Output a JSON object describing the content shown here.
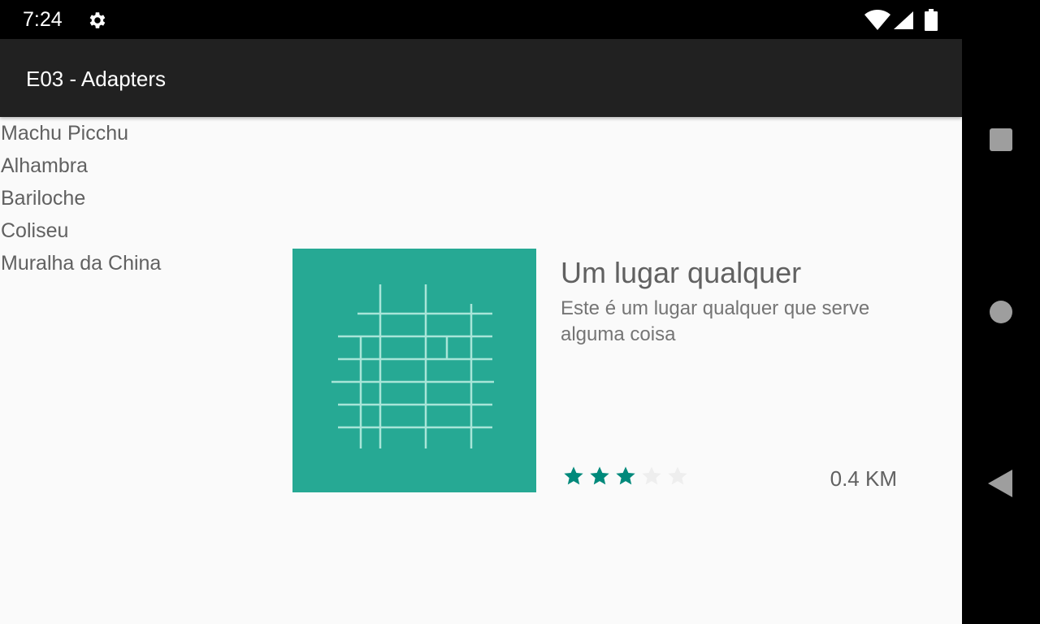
{
  "status_bar": {
    "time": "7:24",
    "icons": [
      "settings-icon",
      "wifi-icon",
      "signal-icon",
      "battery-icon"
    ]
  },
  "app_bar": {
    "title": "E03 - Adapters"
  },
  "places": [
    "Machu Picchu",
    "Alhambra",
    "Bariloche",
    "Coliseu",
    "Muralha da China"
  ],
  "card": {
    "name": "Um lugar qualquer",
    "description": "Este é um lugar qualquer que serve alguma coisa",
    "rating": 3,
    "rating_max": 5,
    "distance": "0.4 KM",
    "image_icon": "building-grid-icon"
  },
  "nav_bar": {
    "icons": [
      "recent-apps-icon",
      "home-icon",
      "back-icon"
    ]
  },
  "colors": {
    "app_bar": "#212121",
    "accent": "#26a994",
    "star_filled": "#00897b",
    "star_empty": "#eeeeee",
    "text": "#616161"
  }
}
